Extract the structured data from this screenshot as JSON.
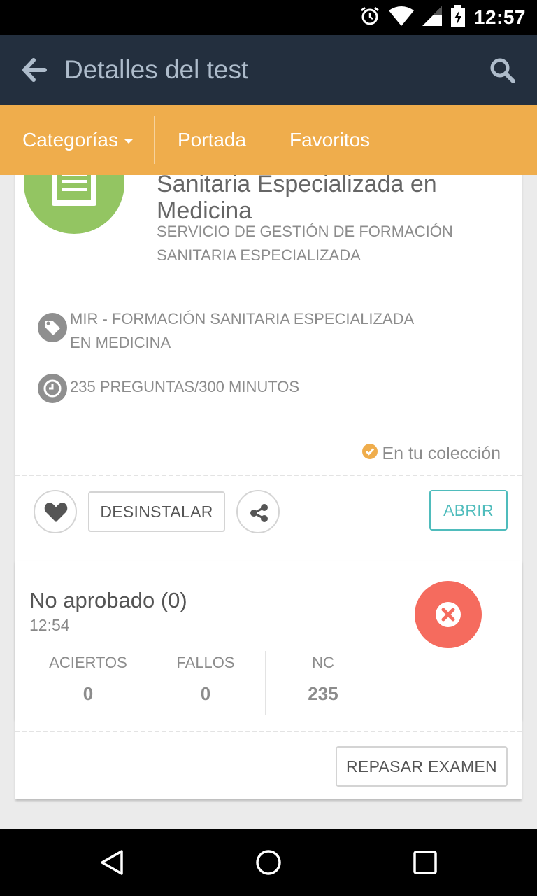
{
  "status_bar": {
    "time": "12:57",
    "icons": [
      "alarm-icon",
      "wifi-icon",
      "signal-icon",
      "battery-icon"
    ]
  },
  "app_bar": {
    "title": "Detalles del test",
    "back_icon": "arrow-left-icon",
    "search_icon": "search-icon"
  },
  "category_bar": {
    "items": [
      "Categorías",
      "Portada",
      "Favoritos"
    ]
  },
  "test": {
    "title_line1": "Sanitaria Especializada en",
    "title_line2": "Medicina",
    "publisher_line1": "SERVICIO DE GESTIÓN DE FORMACIÓN",
    "publisher_line2": "SANITARIA ESPECIALIZADA",
    "category_line1": "MIR - FORMACIÓN SANITARIA ESPECIALIZADA",
    "category_line2": "EN MEDICINA",
    "questions_duration": "235 PREGUNTAS/300 MINUTOS",
    "collection_status": "En tu colección",
    "actions": {
      "uninstall": "DESINSTALAR",
      "open": "ABRIR"
    }
  },
  "result": {
    "status": "No aprobado (0)",
    "time": "12:54",
    "stats": [
      {
        "label": "ACIERTOS",
        "value": "0"
      },
      {
        "label": "FALLOS",
        "value": "0"
      },
      {
        "label": "NC",
        "value": "235"
      }
    ],
    "review_button": "REPASAR EXAMEN"
  },
  "colors": {
    "app_bar": "#232f3e",
    "category_bar": "#efad4c",
    "badge_green": "#93c562",
    "fail_red": "#f56b5e",
    "accent_teal": "#4fbcbc",
    "check_orange": "#efad4c"
  }
}
